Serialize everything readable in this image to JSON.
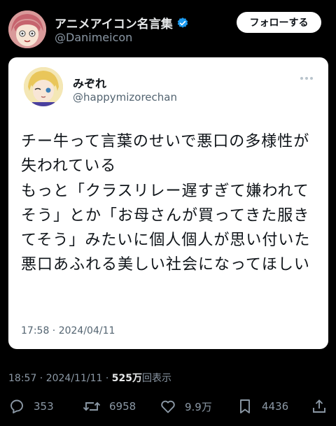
{
  "author": {
    "name": "アニメアイコン名言集",
    "handle": "@Danimeicon",
    "verified": true,
    "follow_label": "フォローする"
  },
  "quoted": {
    "name": "みぞれ",
    "handle": "@happymizorechan",
    "paragraph1": "チー牛って言葉のせいで悪口の多様性が失われている",
    "paragraph2": "もっと「クラスリレー遅すぎて嫌われてそう」とか「お母さんが買ってきた服きてそう」みたいに個人個人が思い付いた悪口あふれる美しい社会になってほしい",
    "timestamp": "17:58 · 2024/04/11"
  },
  "meta": {
    "datetime": "18:57 · 2024/11/11 · ",
    "views_count": "525万",
    "views_label": "回表示"
  },
  "actions": {
    "reply_icon": "reply-icon",
    "reply_count": "353",
    "retweet_icon": "retweet-icon",
    "retweet_count": "6958",
    "like_icon": "heart-icon",
    "like_count": "9.9万",
    "bookmark_icon": "bookmark-icon",
    "bookmark_count": "4436",
    "share_icon": "share-icon"
  },
  "colors": {
    "background": "#000000",
    "verified_blue": "#1d9bf0",
    "muted": "#8b98a5"
  }
}
